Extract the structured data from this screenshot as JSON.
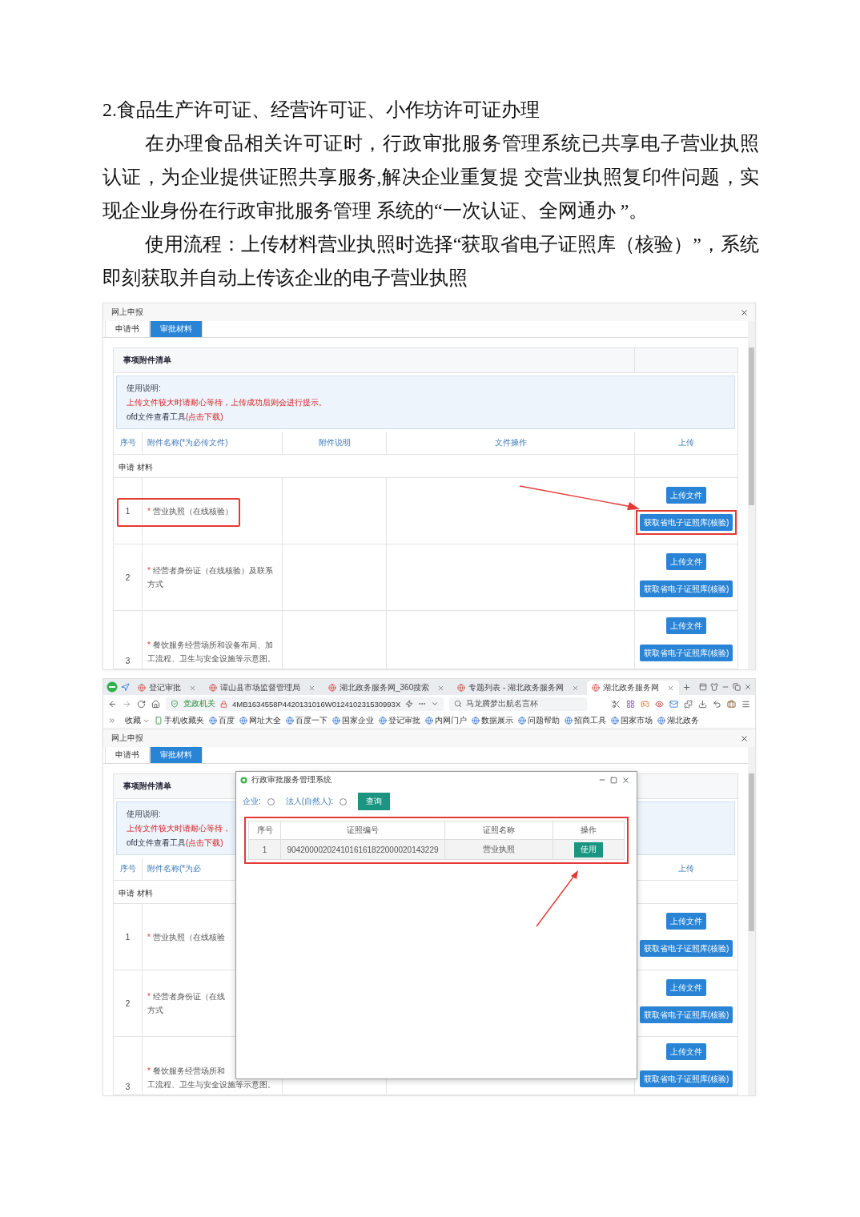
{
  "document": {
    "heading": "2.食品生产许可证、经营许可证、小作坊许可证办理",
    "paragraphs": [
      "在办理食品相关许可证时，行政审批服务管理系统已共享电子营业执照认证，为企业提供证照共享服务,解决企业重复提 交营业执照复印件问题，实现企业身份在行政审批服务管理 系统的“一次认证、全网通办 ”。",
      "使用流程：上传材料营业执照时选择“获取省电子证照库（核验）”，系统即刻获取并自动上传该企业的电子营业执照"
    ]
  },
  "screenshot_1": {
    "dialog": {
      "title": "网上申报",
      "tabs": [
        {
          "label": "申请书",
          "selected": false
        },
        {
          "label": "审批材料",
          "selected": true
        }
      ],
      "card_title": "事项附件清单",
      "notice": {
        "heading": "使用说明:",
        "warning": "上传文件较大时请耐心等待，上传成功后则会进行提示。",
        "tool": "ofd文件查看工具",
        "tool_link": "(点击下载)"
      },
      "columns": [
        {
          "label": "序号"
        },
        {
          "label": "附件名称(*为必传文件)"
        },
        {
          "label": "附件说明"
        },
        {
          "label": "文件操作"
        },
        {
          "label": "上传"
        }
      ],
      "group": "申请 材料",
      "rows": [
        {
          "index": "1",
          "required": "*",
          "name_lines": [
            "营业执照（在线核验）"
          ],
          "highlighted": true,
          "buttons": [
            "上传文件",
            "获取省电子证照库(核验)"
          ]
        },
        {
          "index": "2",
          "required": "*",
          "name_lines": [
            "经营者身份证（在线核验）及联系",
            "方式"
          ],
          "highlighted": false,
          "buttons": [
            "上传文件",
            "获取省电子证照库(核验)"
          ]
        },
        {
          "index": "3",
          "required": "*",
          "name_lines": [
            "餐饮服务经营场所和设备布局、加",
            "工流程、卫生与安全设施等示意图。"
          ],
          "highlighted": false,
          "buttons": [
            "上传文件",
            "获取省电子证照库(核验)"
          ]
        }
      ]
    }
  },
  "screenshot_2": {
    "browser": {
      "tabs": [
        {
          "label": "登记审批",
          "selected": false
        },
        {
          "label": "谭山县市场监督管理局",
          "selected": false
        },
        {
          "label": "湖北政务服务网_360搜索",
          "selected": false
        },
        {
          "label": "专题列表 - 湖北政务服务网",
          "selected": false
        },
        {
          "label": "湖北政务服务网",
          "selected": true
        }
      ],
      "address": {
        "badge": "党政机关",
        "url": "4MB1634558P4420131016W012410231530993X",
        "search": "马龙腾梦出航名言杯"
      },
      "bookmarks": [
        "收藏",
        "手机收藏夹",
        "百度",
        "网址大全",
        "百度一下",
        "国家企业",
        "登记审批",
        "内网门户",
        "数据展示",
        "问题帮助",
        "招商工具",
        "国家市场",
        "湖北政务"
      ]
    },
    "dialog": {
      "title": "网上申报",
      "tabs": [
        {
          "label": "申请书",
          "selected": false
        },
        {
          "label": "审批材料",
          "selected": true
        }
      ],
      "card_title": "事项附件清单",
      "notice": {
        "heading": "使用说明:",
        "warning": "上传文件较大时请耐心等待，",
        "tool": "ofd文件查看工具",
        "tool_link": "(点击下载)"
      },
      "columns": [
        {
          "label": "序号"
        },
        {
          "label": "附件名称(*为必"
        },
        {},
        {},
        {
          "label": "上传"
        }
      ],
      "group": "申请 材料",
      "rows": [
        {
          "index": "1",
          "required": "*",
          "name_lines": [
            "营业执照（在线核验"
          ],
          "highlighted": false,
          "buttons": [
            "上传文件",
            "获取省电子证照库(核验)"
          ]
        },
        {
          "index": "2",
          "required": "*",
          "name_lines": [
            "经营者身份证（在线",
            "方式"
          ],
          "highlighted": false,
          "buttons": [
            "上传文件",
            "获取省电子证照库(核验)"
          ]
        },
        {
          "index": "3",
          "required": "*",
          "name_lines": [
            "餐饮服务经营场所和",
            "工流程、卫生与安全设施等示意图。"
          ],
          "highlighted": false,
          "buttons": [
            "上传文件",
            "获取省电子证照库(核验)"
          ]
        }
      ]
    },
    "modal": {
      "title": "行政审批服务管理系统",
      "filters": [
        {
          "label": "企业:",
          "checked": false
        },
        {
          "label": "法人(自然人):",
          "checked": false
        }
      ],
      "search_button": "查询",
      "highlighted": true,
      "columns": [
        "序号",
        "证照编号",
        "证照名称",
        "操作"
      ],
      "rows": [
        {
          "index": "1",
          "number": "9042000020241016161822000020143229",
          "name": "营业执照",
          "action": "使用"
        }
      ]
    }
  }
}
